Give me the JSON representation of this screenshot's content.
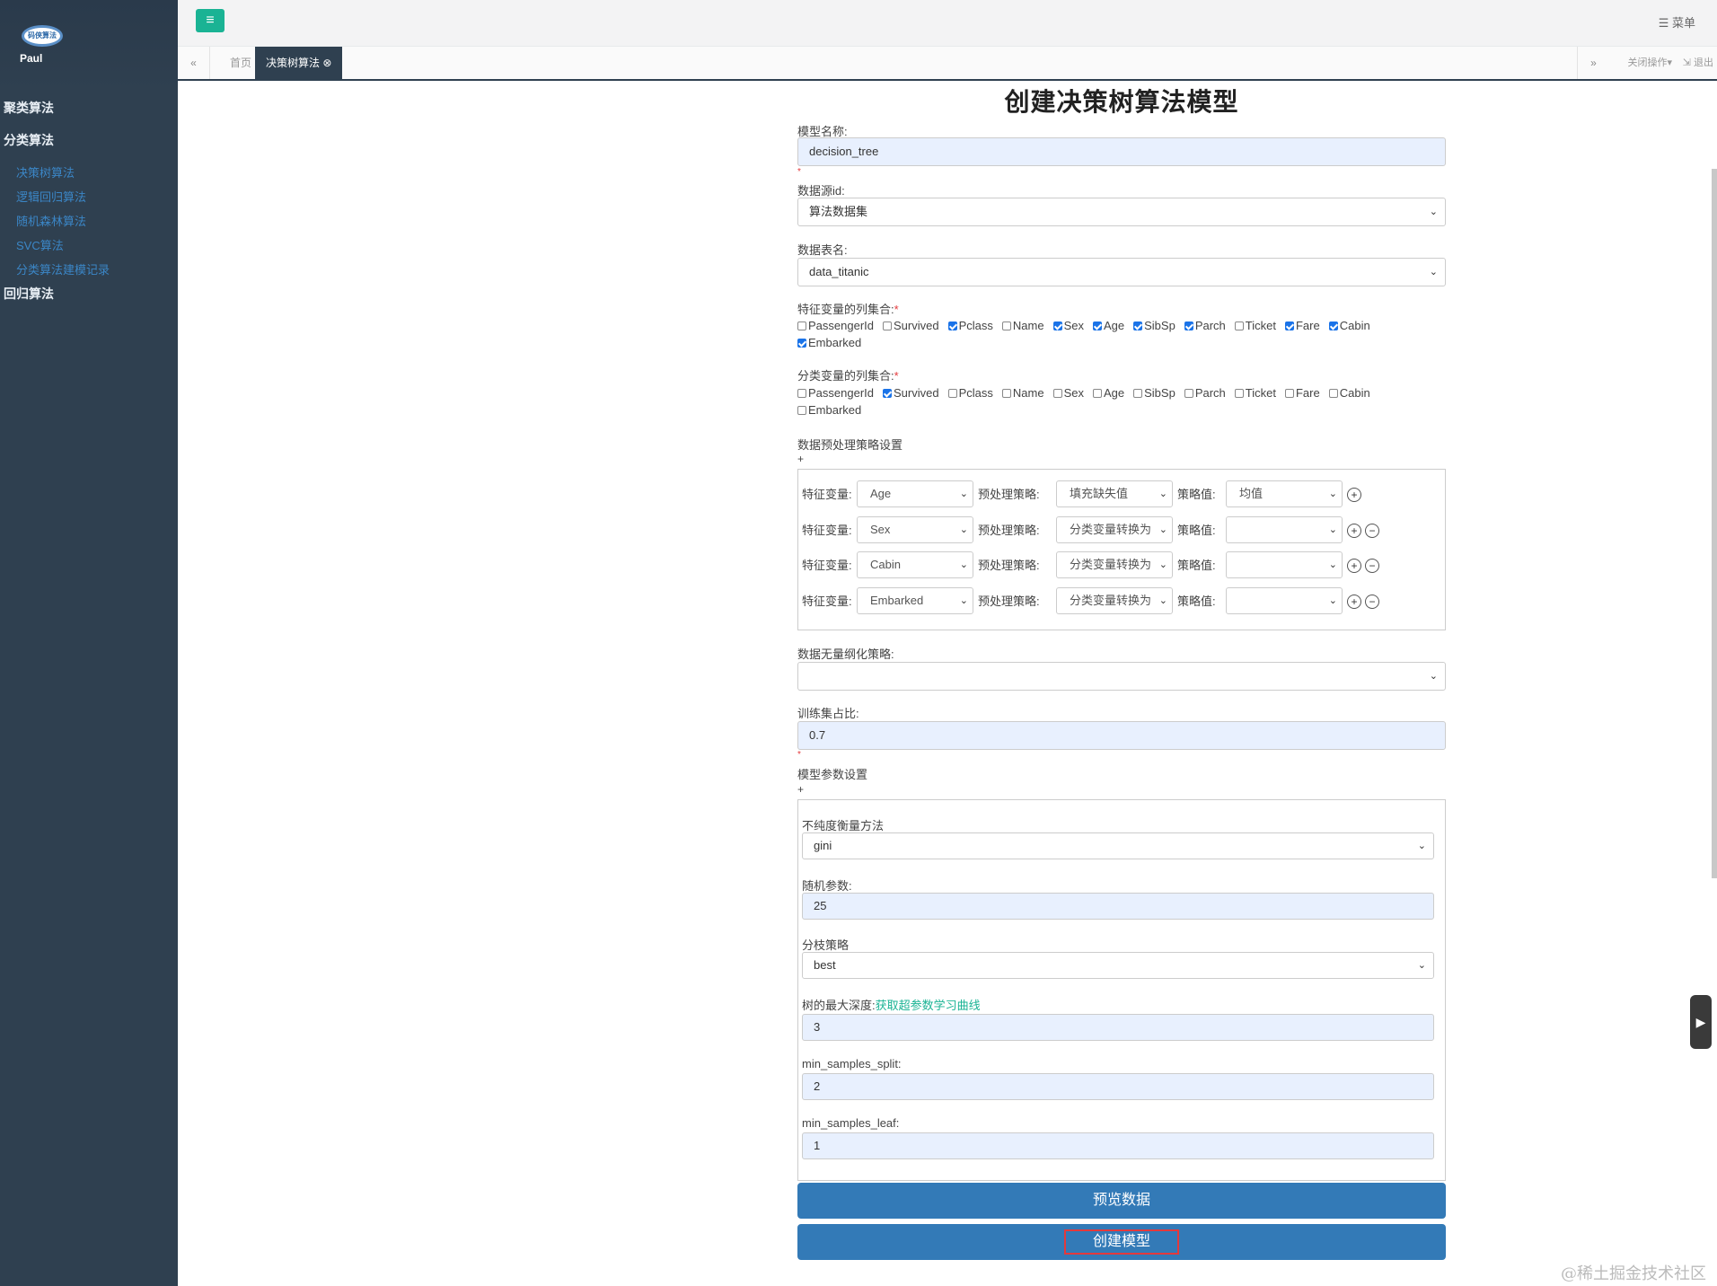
{
  "sidebar": {
    "logo_text": "码侠算法",
    "user_name": "Paul",
    "categories": [
      {
        "label": "聚类算法"
      },
      {
        "label": "分类算法"
      },
      {
        "label": "回归算法"
      }
    ],
    "sub_items": [
      {
        "label": "决策树算法"
      },
      {
        "label": "逻辑回归算法"
      },
      {
        "label": "随机森林算法"
      },
      {
        "label": "SVC算法"
      },
      {
        "label": "分类算法建模记录"
      }
    ]
  },
  "topbar": {
    "menu_label": "菜单"
  },
  "tabs": {
    "home": "首页",
    "active": "决策树算法",
    "close_ops": "关闭操作",
    "logout": "退出"
  },
  "form": {
    "title": "创建决策树算法模型",
    "model_name_label": "模型名称:",
    "model_name_value": "decision_tree",
    "datasource_label": "数据源id:",
    "datasource_value": "算法数据集",
    "table_label": "数据表名:",
    "table_value": "data_titanic",
    "feature_cols_label": "特征变量的列集合:",
    "class_cols_label": "分类变量的列集合:",
    "columns": [
      "PassengerId",
      "Survived",
      "Pclass",
      "Name",
      "Sex",
      "Age",
      "SibSp",
      "Parch",
      "Ticket",
      "Fare",
      "Cabin",
      "Embarked"
    ],
    "feature_checked": [
      false,
      false,
      true,
      false,
      true,
      true,
      true,
      true,
      false,
      true,
      true,
      true
    ],
    "class_checked": [
      false,
      true,
      false,
      false,
      false,
      false,
      false,
      false,
      false,
      false,
      false,
      false
    ],
    "preprocess_label": "数据预处理策略设置",
    "plus": "+",
    "preprocess_rows": [
      {
        "feature_label": "特征变量:",
        "feature": "Age",
        "strategy_label": "预处理策略:",
        "strategy": "填充缺失值",
        "value_label": "策略值:",
        "value": "均值",
        "minus": false
      },
      {
        "feature_label": "特征变量:",
        "feature": "Sex",
        "strategy_label": "预处理策略:",
        "strategy": "分类变量转换为",
        "value_label": "策略值:",
        "value": "",
        "minus": true
      },
      {
        "feature_label": "特征变量:",
        "feature": "Cabin",
        "strategy_label": "预处理策略:",
        "strategy": "分类变量转换为",
        "value_label": "策略值:",
        "value": "",
        "minus": true
      },
      {
        "feature_label": "特征变量:",
        "feature": "Embarked",
        "strategy_label": "预处理策略:",
        "strategy": "分类变量转换为",
        "value_label": "策略值:",
        "value": "",
        "minus": true
      }
    ],
    "normalize_label": "数据无量纲化策略:",
    "normalize_value": "",
    "train_ratio_label": "训练集占比:",
    "train_ratio_value": "0.7",
    "model_params_label": "模型参数设置",
    "params": {
      "impurity_label": "不纯度衡量方法",
      "impurity_value": "gini",
      "random_label": "随机参数:",
      "random_value": "25",
      "splitter_label": "分枝策略",
      "splitter_value": "best",
      "max_depth_label": "树的最大深度:",
      "max_depth_link": "获取超参数学习曲线",
      "max_depth_value": "3",
      "min_split_label": "min_samples_split:",
      "min_split_value": "2",
      "min_leaf_label": "min_samples_leaf:",
      "min_leaf_value": "1"
    },
    "preview_button": "预览数据",
    "create_button": "创建模型"
  },
  "watermark": "@稀土掘金技术社区",
  "colors": {
    "sidebar": "#2f4050",
    "accent": "#1ab394",
    "button": "#337ab7",
    "highlight": "#e4393c"
  }
}
